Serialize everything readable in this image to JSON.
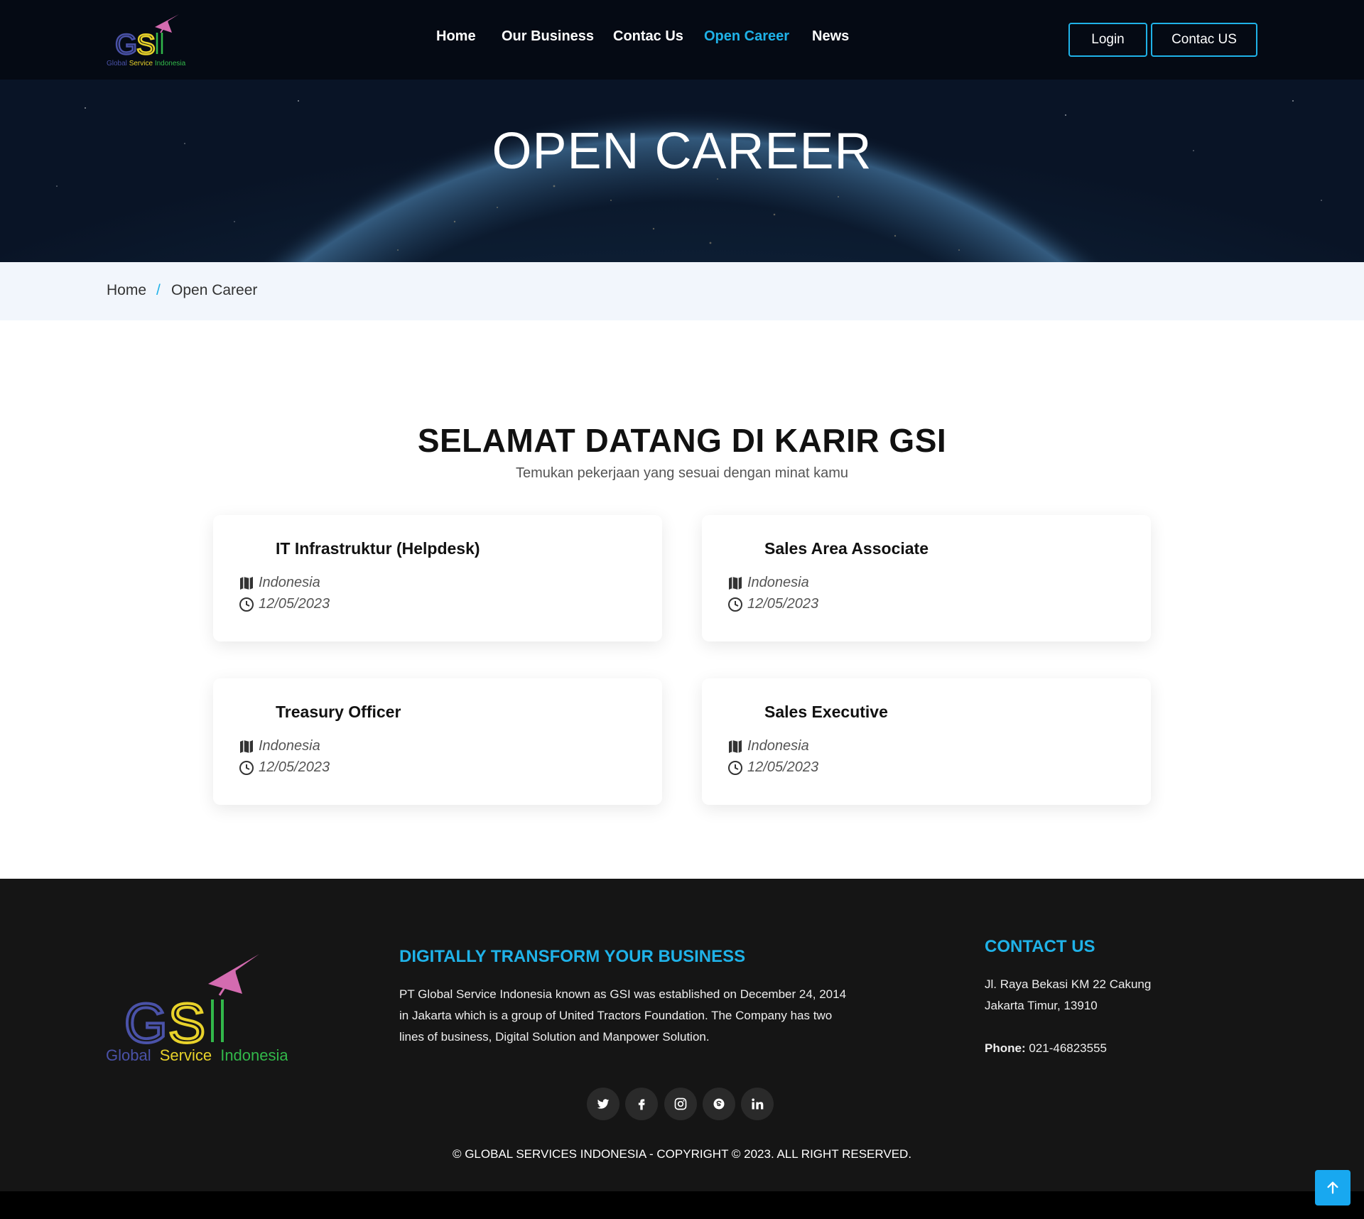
{
  "header": {
    "logo": {
      "letters": "GSI",
      "tagline": "Global Service Indonesia"
    },
    "nav": [
      "Home",
      "Our Business",
      "Contac Us",
      "Open Career",
      "News"
    ],
    "active_nav": "Open Career",
    "login_label": "Login",
    "contact_label": "Contac US"
  },
  "hero": {
    "title": "OPEN CAREER"
  },
  "breadcrumb": {
    "home": "Home",
    "separator": "/",
    "current": "Open Career"
  },
  "main": {
    "heading": "SELAMAT DATANG DI KARIR GSI",
    "subheading": "Temukan pekerjaan yang sesuai dengan minat kamu",
    "jobs": [
      {
        "title": "IT Infrastruktur (Helpdesk)",
        "location": "Indonesia",
        "date": "12/05/2023"
      },
      {
        "title": "Sales Area Associate",
        "location": "Indonesia",
        "date": "12/05/2023"
      },
      {
        "title": "Treasury Officer",
        "location": "Indonesia",
        "date": "12/05/2023"
      },
      {
        "title": "Sales Executive",
        "location": "Indonesia",
        "date": "12/05/2023"
      }
    ]
  },
  "footer": {
    "logo": {
      "letters": "GSI",
      "tagline_1": "Global",
      "tagline_2": "Service",
      "tagline_3": "Indonesia"
    },
    "about_heading": "DIGITALLY TRANSFORM YOUR BUSINESS",
    "about_lines": [
      "PT Global Service Indonesia known as GSI was established on December 24, 2014",
      "in Jakarta which is a group of United Tractors Foundation. The Company has two",
      "lines of business, Digital Solution and Manpower Solution."
    ],
    "contact_heading": "CONTACT US",
    "address_1": "Jl. Raya Bekasi KM 22 Cakung",
    "address_2": "Jakarta Timur, 13910",
    "phone_label": "Phone:",
    "phone": "021-46823555",
    "social": [
      "twitter-icon",
      "facebook-icon",
      "instagram-icon",
      "skype-icon",
      "linkedin-icon"
    ],
    "copyright": "© GLOBAL SERVICES INDONESIA - COPYRIGHT © 2023. ALL RIGHT RESERVED."
  },
  "colors": {
    "accent": "#1fb2e8",
    "header_bg": "#050a14",
    "footer_bg": "#151515",
    "back_to_top": "#18a8f0"
  }
}
